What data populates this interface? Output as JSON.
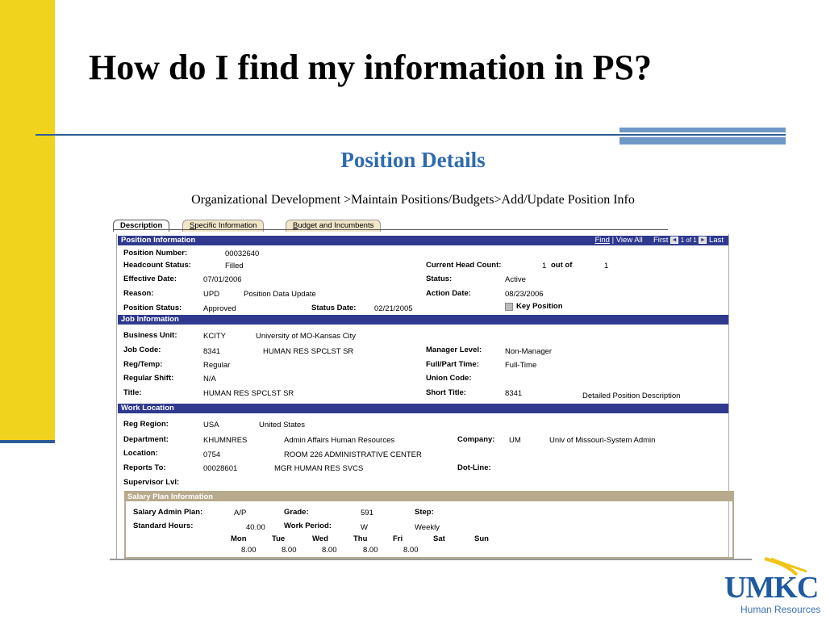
{
  "slide": {
    "title": "How do I find my information in PS?",
    "subtitle": "Position Details",
    "nav_path": "Organizational Development >Maintain Positions/Budgets>Add/Update Position Info"
  },
  "tabs": [
    {
      "label": "Description",
      "active": true
    },
    {
      "label_underline": "S",
      "label_rest": "pecific Information",
      "active": false
    },
    {
      "label_underline": "B",
      "label_rest": "udget and Incumbents",
      "active": false
    }
  ],
  "position_info": {
    "header": "Position Information",
    "nav": {
      "find": "Find",
      "sep": "|",
      "view_all": "View All",
      "first": "First",
      "prev_icon": "◄",
      "page": "1 of 1",
      "next_icon": "►",
      "last": "Last"
    },
    "position_number_label": "Position Number:",
    "position_number": "00032640",
    "headcount_status_label": "Headcount Status:",
    "headcount_status": "Filled",
    "current_head_count_label": "Current Head Count:",
    "current_head_count": "1",
    "out_of_label": "out of",
    "out_of_value": "1",
    "effective_date_label": "Effective Date:",
    "effective_date": "07/01/2006",
    "status_label": "Status:",
    "status": "Active",
    "reason_label": "Reason:",
    "reason_code": "UPD",
    "reason_desc": "Position Data Update",
    "action_date_label": "Action Date:",
    "action_date": "08/23/2006",
    "position_status_label": "Position Status:",
    "position_status": "Approved",
    "status_date_label": "Status Date:",
    "status_date": "02/21/2005",
    "key_position_label": "Key Position"
  },
  "job_info": {
    "header": "Job Information",
    "business_unit_label": "Business Unit:",
    "business_unit": "KCITY",
    "business_unit_desc": "University of MO-Kansas City",
    "job_code_label": "Job Code:",
    "job_code": "8341",
    "job_code_desc": "HUMAN RES SPCLST SR",
    "manager_level_label": "Manager Level:",
    "manager_level": "Non-Manager",
    "reg_temp_label": "Reg/Temp:",
    "reg_temp": "Regular",
    "full_part_label": "Full/Part Time:",
    "full_part": "Full-Time",
    "regular_shift_label": "Regular Shift:",
    "regular_shift": "N/A",
    "union_code_label": "Union Code:",
    "title_label": "Title:",
    "title": "HUMAN RES SPCLST SR",
    "short_title_label": "Short Title:",
    "short_title": "8341",
    "detailed_desc_link": "Detailed Position Description"
  },
  "work_location": {
    "header": "Work Location",
    "reg_region_label": "Reg Region:",
    "reg_region": "USA",
    "reg_region_desc": "United States",
    "department_label": "Department:",
    "department": "KHUMNRES",
    "department_desc": "Admin Affairs Human Resources",
    "company_label": "Company:",
    "company": "UM",
    "company_desc": "Univ of Missouri-System Admin",
    "location_label": "Location:",
    "location": "0754",
    "location_desc": "ROOM 226 ADMINISTRATIVE CENTER",
    "reports_to_label": "Reports To:",
    "reports_to": "00028601",
    "reports_to_desc": "MGR HUMAN RES SVCS",
    "dot_line_label": "Dot-Line:",
    "supervisor_lvl_label": "Supervisor Lvl:"
  },
  "salary_plan": {
    "header": "Salary Plan Information",
    "admin_plan_label": "Salary Admin Plan:",
    "admin_plan": "A/P",
    "grade_label": "Grade:",
    "grade": "591",
    "step_label": "Step:",
    "std_hours_label": "Standard Hours:",
    "std_hours": "40.00",
    "work_period_label": "Work Period:",
    "work_period": "W",
    "work_period_desc": "Weekly",
    "days": [
      "Mon",
      "Tue",
      "Wed",
      "Thu",
      "Fri",
      "Sat",
      "Sun"
    ],
    "hours": [
      "8.00",
      "8.00",
      "8.00",
      "8.00",
      "8.00",
      "",
      ""
    ]
  },
  "logo": {
    "name": "UMKC",
    "sub": "Human Resources"
  },
  "colors": {
    "yellow": "#f0d31c",
    "blue_rule": "#2e5c95",
    "band": "#2f3a8f",
    "subtitle": "#2e6aaf",
    "salary_band": "#b8aa8c"
  }
}
